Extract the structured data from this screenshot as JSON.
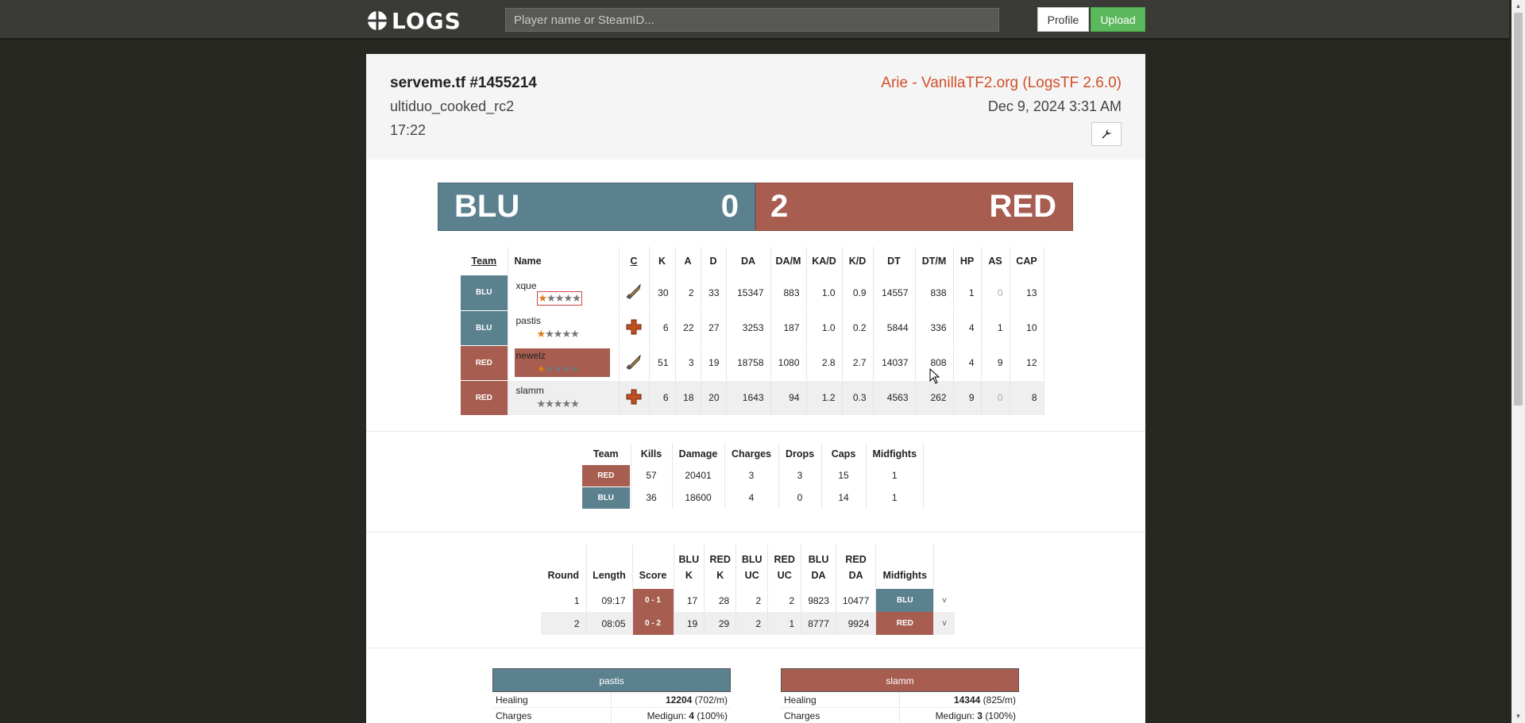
{
  "nav": {
    "logo_text": "LOGS",
    "search_placeholder": "Player name or SteamID...",
    "profile_label": "Profile",
    "upload_label": "Upload"
  },
  "log": {
    "title": "serveme.tf #1455214",
    "map": "ultiduo_cooked_rc2",
    "duration": "17:22",
    "plugin": "Arie - VanillaTF2.org (LogsTF 2.6.0)",
    "date": "Dec 9, 2024 3:31 AM"
  },
  "score": {
    "blu_label": "BLU",
    "blu_score": "0",
    "red_score": "2",
    "red_label": "RED"
  },
  "players": {
    "headers": [
      "Team",
      "Name",
      "C",
      "K",
      "A",
      "D",
      "DA",
      "DA/M",
      "KA/D",
      "K/D",
      "DT",
      "DT/M",
      "HP",
      "AS",
      "CAP"
    ],
    "rows": [
      {
        "team": "BLU",
        "name": "xque",
        "class_icon": "soldier-rocket-icon",
        "k": "30",
        "a": "2",
        "d": "33",
        "da": "15347",
        "dam": "883",
        "kad": "1.0",
        "kd": "0.9",
        "dt": "14557",
        "dtm": "838",
        "hp": "1",
        "as": "0",
        "cap": "13"
      },
      {
        "team": "BLU",
        "name": "pastis",
        "class_icon": "medic-cross-icon",
        "k": "6",
        "a": "22",
        "d": "27",
        "da": "3253",
        "dam": "187",
        "kad": "1.0",
        "kd": "0.2",
        "dt": "5844",
        "dtm": "336",
        "hp": "4",
        "as": "1",
        "cap": "10"
      },
      {
        "team": "RED",
        "name": "newelz",
        "class_icon": "soldier-rocket-icon",
        "k": "51",
        "a": "3",
        "d": "19",
        "da": "18758",
        "dam": "1080",
        "kad": "2.8",
        "kd": "2.7",
        "dt": "14037",
        "dtm": "808",
        "hp": "4",
        "as": "9",
        "cap": "12"
      },
      {
        "team": "RED",
        "name": "slamm",
        "class_icon": "medic-cross-icon",
        "k": "6",
        "a": "18",
        "d": "20",
        "da": "1643",
        "dam": "94",
        "kad": "1.2",
        "kd": "0.3",
        "dt": "4563",
        "dtm": "262",
        "hp": "9",
        "as": "0",
        "cap": "8"
      }
    ]
  },
  "team_summary": {
    "headers": [
      "Team",
      "Kills",
      "Damage",
      "Charges",
      "Drops",
      "Caps",
      "Midfights"
    ],
    "rows": [
      {
        "team": "RED",
        "kills": "57",
        "damage": "20401",
        "charges": "3",
        "drops": "3",
        "caps": "15",
        "midfights": "1"
      },
      {
        "team": "BLU",
        "kills": "36",
        "damage": "18600",
        "charges": "4",
        "drops": "0",
        "caps": "14",
        "midfights": "1"
      }
    ]
  },
  "rounds": {
    "headers": [
      "Round",
      "Length",
      "Score",
      "BLU K",
      "RED K",
      "BLU UC",
      "RED UC",
      "BLU DA",
      "RED DA",
      "Midfights"
    ],
    "header_lines": [
      [
        "Round"
      ],
      [
        "Length"
      ],
      [
        "Score"
      ],
      [
        "BLU",
        "K"
      ],
      [
        "RED",
        "K"
      ],
      [
        "BLU",
        "UC"
      ],
      [
        "RED",
        "UC"
      ],
      [
        "BLU",
        "DA"
      ],
      [
        "RED",
        "DA"
      ],
      [
        "Midfights"
      ]
    ],
    "rows": [
      {
        "round": "1",
        "length": "09:17",
        "score": "0 - 1",
        "blu_k": "17",
        "red_k": "28",
        "blu_uc": "2",
        "red_uc": "2",
        "blu_da": "9823",
        "red_da": "10477",
        "midfight": "BLU",
        "expand": "v"
      },
      {
        "round": "2",
        "length": "08:05",
        "score": "0 - 2",
        "blu_k": "19",
        "red_k": "29",
        "blu_uc": "2",
        "red_uc": "1",
        "blu_da": "8777",
        "red_da": "9924",
        "midfight": "RED",
        "expand": "v"
      }
    ]
  },
  "medics": [
    {
      "name": "pastis",
      "team": "BLU",
      "healing_label": "Healing",
      "healing_value": "12204",
      "healing_rate": "(702/m)",
      "charges_label": "Charges",
      "charges_prefix": "Medigun:",
      "charges_value": "4",
      "charges_pct": "(100%)"
    },
    {
      "name": "slamm",
      "team": "RED",
      "healing_label": "Healing",
      "healing_value": "14344",
      "healing_rate": "(825/m)",
      "charges_label": "Charges",
      "charges_prefix": "Medigun:",
      "charges_value": "3",
      "charges_pct": "(100%)"
    }
  ],
  "colors": {
    "blu": "#5b818f",
    "red": "#a75d50",
    "accent_orange": "#d0502b",
    "upload_green": "#5cb85c"
  }
}
